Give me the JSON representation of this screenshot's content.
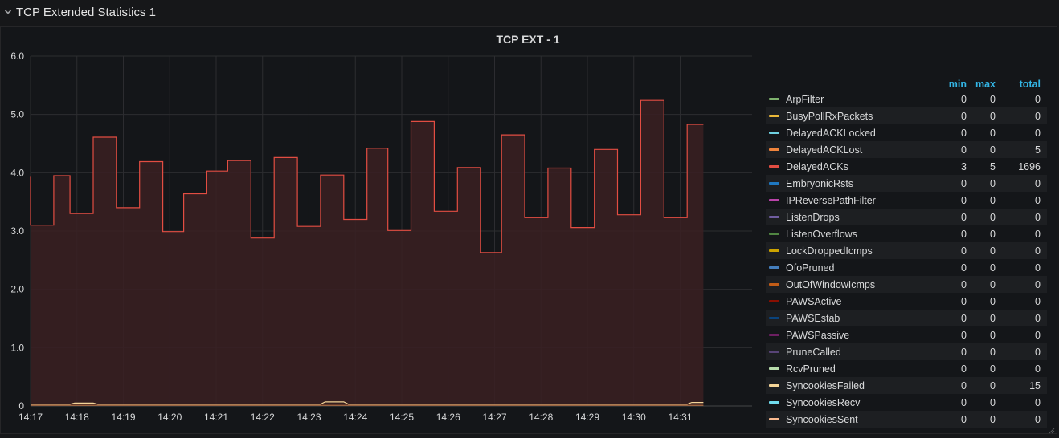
{
  "row": {
    "title": "TCP Extended Statistics 1"
  },
  "panel": {
    "title": "TCP EXT - 1"
  },
  "colors": {
    "background": "#161719",
    "panel": "#141619",
    "grid": "#2c2d30",
    "text": "#d8d9da",
    "legend_header": "#33b5e5",
    "main_series": "#e24d42",
    "main_fill": "#3a2022"
  },
  "legend": {
    "columns": {
      "min": "min",
      "max": "max",
      "total": "total"
    },
    "items": [
      {
        "name": "ArpFilter",
        "color": "#7eb26d",
        "min": "0",
        "max": "0",
        "total": "0"
      },
      {
        "name": "BusyPollRxPackets",
        "color": "#eab839",
        "min": "0",
        "max": "0",
        "total": "0"
      },
      {
        "name": "DelayedACKLocked",
        "color": "#6ed0e0",
        "min": "0",
        "max": "0",
        "total": "0"
      },
      {
        "name": "DelayedACKLost",
        "color": "#ef843c",
        "min": "0",
        "max": "0",
        "total": "5"
      },
      {
        "name": "DelayedACKs",
        "color": "#e24d42",
        "min": "3",
        "max": "5",
        "total": "1696"
      },
      {
        "name": "EmbryonicRsts",
        "color": "#1f78c1",
        "min": "0",
        "max": "0",
        "total": "0"
      },
      {
        "name": "IPReversePathFilter",
        "color": "#ba43a9",
        "min": "0",
        "max": "0",
        "total": "0"
      },
      {
        "name": "ListenDrops",
        "color": "#705da0",
        "min": "0",
        "max": "0",
        "total": "0"
      },
      {
        "name": "ListenOverflows",
        "color": "#508642",
        "min": "0",
        "max": "0",
        "total": "0"
      },
      {
        "name": "LockDroppedIcmps",
        "color": "#cca300",
        "min": "0",
        "max": "0",
        "total": "0"
      },
      {
        "name": "OfoPruned",
        "color": "#447ebc",
        "min": "0",
        "max": "0",
        "total": "0"
      },
      {
        "name": "OutOfWindowIcmps",
        "color": "#c15c17",
        "min": "0",
        "max": "0",
        "total": "0"
      },
      {
        "name": "PAWSActive",
        "color": "#890f02",
        "min": "0",
        "max": "0",
        "total": "0"
      },
      {
        "name": "PAWSEstab",
        "color": "#0a437c",
        "min": "0",
        "max": "0",
        "total": "0"
      },
      {
        "name": "PAWSPassive",
        "color": "#6d1f62",
        "min": "0",
        "max": "0",
        "total": "0"
      },
      {
        "name": "PruneCalled",
        "color": "#584477",
        "min": "0",
        "max": "0",
        "total": "0"
      },
      {
        "name": "RcvPruned",
        "color": "#b7dbab",
        "min": "0",
        "max": "0",
        "total": "0"
      },
      {
        "name": "SyncookiesFailed",
        "color": "#f4d598",
        "min": "0",
        "max": "0",
        "total": "15"
      },
      {
        "name": "SyncookiesRecv",
        "color": "#70dbed",
        "min": "0",
        "max": "0",
        "total": "0"
      },
      {
        "name": "SyncookiesSent",
        "color": "#f9ba8f",
        "min": "0",
        "max": "0",
        "total": "0"
      }
    ]
  },
  "chart_data": {
    "type": "line",
    "ylim": [
      0,
      6
    ],
    "yticks": [
      0,
      1,
      2,
      3,
      4,
      5,
      6
    ],
    "ytick_labels": [
      "0",
      "1.0",
      "2.0",
      "3.0",
      "4.0",
      "5.0",
      "6.0"
    ],
    "xlim": [
      0,
      15.55
    ],
    "xticks": [
      0,
      1,
      2,
      3,
      4,
      5,
      6,
      7,
      8,
      9,
      10,
      11,
      12,
      13,
      14
    ],
    "xtick_labels": [
      "14:17",
      "14:18",
      "14:19",
      "14:20",
      "14:21",
      "14:22",
      "14:23",
      "14:24",
      "14:25",
      "14:26",
      "14:27",
      "14:28",
      "14:29",
      "14:30",
      "14:31"
    ],
    "series": [
      {
        "name": "DelayedACKs",
        "color": "#e24d42",
        "fill": true,
        "points": [
          [
            -0.15,
            3.93
          ],
          [
            -0.08,
            3.93
          ],
          [
            -0.08,
            3.1
          ],
          [
            0.5,
            3.1
          ],
          [
            0.5,
            3.95
          ],
          [
            0.85,
            3.95
          ],
          [
            0.85,
            3.3
          ],
          [
            1.35,
            3.3
          ],
          [
            1.35,
            4.61
          ],
          [
            1.85,
            4.61
          ],
          [
            1.85,
            3.4
          ],
          [
            2.35,
            3.4
          ],
          [
            2.35,
            4.19
          ],
          [
            2.85,
            4.19
          ],
          [
            2.85,
            2.99
          ],
          [
            3.3,
            2.99
          ],
          [
            3.3,
            3.64
          ],
          [
            3.8,
            3.64
          ],
          [
            3.8,
            4.03
          ],
          [
            4.25,
            4.03
          ],
          [
            4.25,
            4.21
          ],
          [
            4.75,
            4.21
          ],
          [
            4.75,
            2.88
          ],
          [
            5.25,
            2.88
          ],
          [
            5.25,
            4.26
          ],
          [
            5.75,
            4.26
          ],
          [
            5.75,
            3.08
          ],
          [
            6.25,
            3.08
          ],
          [
            6.25,
            3.96
          ],
          [
            6.75,
            3.96
          ],
          [
            6.75,
            3.2
          ],
          [
            7.25,
            3.2
          ],
          [
            7.25,
            4.42
          ],
          [
            7.7,
            4.42
          ],
          [
            7.7,
            3.01
          ],
          [
            8.2,
            3.01
          ],
          [
            8.2,
            4.88
          ],
          [
            8.7,
            4.88
          ],
          [
            8.7,
            3.34
          ],
          [
            9.2,
            3.34
          ],
          [
            9.2,
            4.09
          ],
          [
            9.7,
            4.09
          ],
          [
            9.7,
            2.63
          ],
          [
            10.15,
            2.63
          ],
          [
            10.15,
            4.65
          ],
          [
            10.65,
            4.65
          ],
          [
            10.65,
            3.23
          ],
          [
            11.15,
            3.23
          ],
          [
            11.15,
            4.08
          ],
          [
            11.65,
            4.08
          ],
          [
            11.65,
            3.06
          ],
          [
            12.15,
            3.06
          ],
          [
            12.15,
            4.4
          ],
          [
            12.65,
            4.4
          ],
          [
            12.65,
            3.28
          ],
          [
            13.15,
            3.28
          ],
          [
            13.15,
            5.24
          ],
          [
            13.65,
            5.24
          ],
          [
            13.65,
            3.23
          ],
          [
            14.15,
            3.23
          ],
          [
            14.15,
            4.83
          ],
          [
            14.5,
            4.83
          ]
        ]
      },
      {
        "name": "SyncookiesFailed",
        "color": "#f4d598",
        "fill": false,
        "points": [
          [
            -0.15,
            0.03
          ],
          [
            0.85,
            0.03
          ],
          [
            0.95,
            0.05
          ],
          [
            1.35,
            0.05
          ],
          [
            1.45,
            0.03
          ],
          [
            6.25,
            0.03
          ],
          [
            6.35,
            0.07
          ],
          [
            6.75,
            0.07
          ],
          [
            6.85,
            0.03
          ],
          [
            14.15,
            0.03
          ],
          [
            14.25,
            0.06
          ],
          [
            14.5,
            0.06
          ]
        ]
      },
      {
        "name": "DelayedACKLost",
        "color": "#ef843c",
        "fill": false,
        "points": [
          [
            -0.15,
            0.01
          ],
          [
            14.5,
            0.01
          ]
        ]
      }
    ]
  }
}
